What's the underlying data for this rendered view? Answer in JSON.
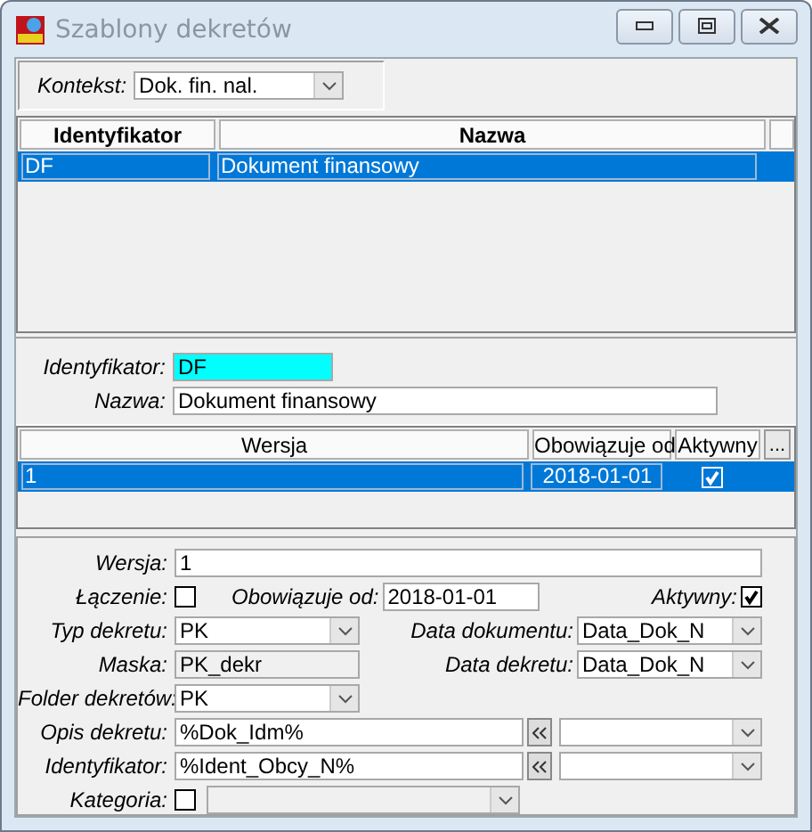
{
  "window": {
    "title": "Szablony dekretów"
  },
  "context": {
    "label": "Kontekst:",
    "value": "Dok. fin. nal."
  },
  "templates_table": {
    "columns": [
      "Identyfikator",
      "Nazwa"
    ],
    "rows": [
      {
        "cells": [
          "DF",
          "Dokument finansowy"
        ],
        "selected": true
      }
    ]
  },
  "template_detail": {
    "identifier_label": "Identyfikator:",
    "identifier": "DF",
    "name_label": "Nazwa:",
    "name": "Dokument finansowy"
  },
  "versions_table": {
    "columns": [
      "Wersja",
      "Obowiązuje od",
      "Aktywny"
    ],
    "more_button": "...",
    "rows": [
      {
        "version": "1",
        "valid_from": "2018-01-01",
        "active": true,
        "selected": true
      }
    ]
  },
  "version_form": {
    "version": {
      "label": "Wersja:",
      "value": "1"
    },
    "joining": {
      "label": "Łączenie:",
      "checked": false
    },
    "valid_from": {
      "label": "Obowiązuje od:",
      "value": "2018-01-01"
    },
    "active": {
      "label": "Aktywny:",
      "checked": true
    },
    "type": {
      "label": "Typ dekretu:",
      "value": "PK"
    },
    "document_date": {
      "label": "Data dokumentu:",
      "value": "Data_Dok_N"
    },
    "mask": {
      "label": "Maska:",
      "value": "PK_dekr"
    },
    "decree_date": {
      "label": "Data dekretu:",
      "value": "Data_Dok_N"
    },
    "folder": {
      "label": "Folder dekretów:",
      "value": "PK"
    },
    "description": {
      "label": "Opis dekretu:",
      "value": "%Dok_Idm%"
    },
    "identifier": {
      "label": "Identyfikator:",
      "value": "%Ident_Obcy_N%"
    },
    "category": {
      "label": "Kategoria:",
      "checked": false
    }
  }
}
